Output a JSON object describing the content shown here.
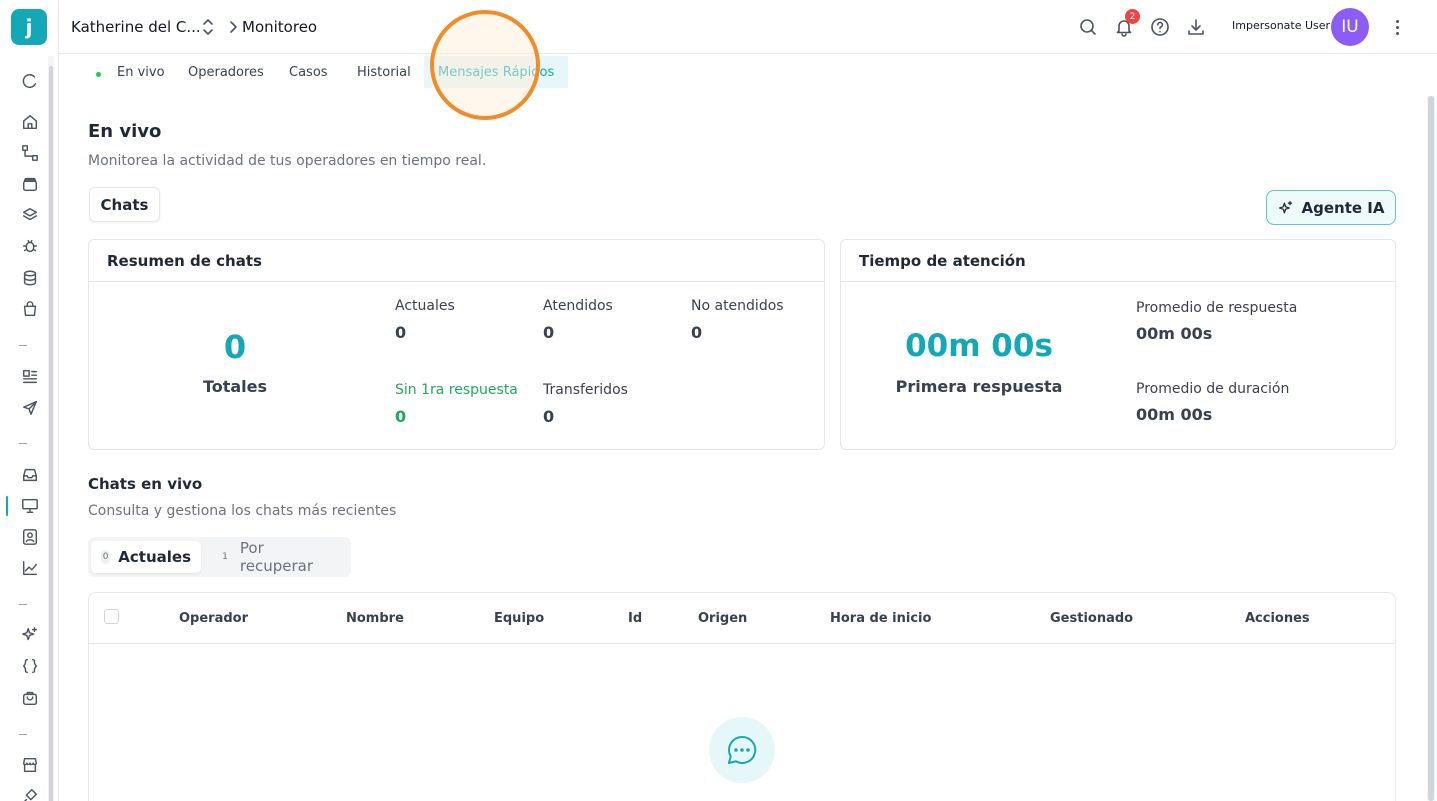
{
  "app": {
    "logo_letter": "j",
    "brand_color": "#13a8b7"
  },
  "header": {
    "breadcrumb_user": "Katherine del C...",
    "breadcrumb_page": "Monitoreo",
    "notification_count": "2",
    "impersonate_label": "Impersonate User",
    "avatar_initials": "IU"
  },
  "tabs": [
    {
      "label": "En vivo"
    },
    {
      "label": "Operadores"
    },
    {
      "label": "Casos"
    },
    {
      "label": "Historial"
    },
    {
      "label": "Mensajes Rápidos",
      "active": true
    }
  ],
  "page": {
    "title": "En vivo",
    "subtitle": "Monitorea la actividad de tus operadores en tiempo real.",
    "chats_button": "Chats",
    "agent_button": "Agente IA"
  },
  "summary": {
    "title": "Resumen de chats",
    "total_value": "0",
    "total_label": "Totales",
    "actuales_label": "Actuales",
    "actuales_value": "0",
    "atendidos_label": "Atendidos",
    "atendidos_value": "0",
    "no_atendidos_label": "No atendidos",
    "no_atendidos_value": "0",
    "sin_respuesta_label": "Sin 1ra respuesta",
    "sin_respuesta_value": "0",
    "transferidos_label": "Transferidos",
    "transferidos_value": "0"
  },
  "attention": {
    "title": "Tiempo de atención",
    "first_value": "00m 00s",
    "first_label": "Primera respuesta",
    "avg_response_label": "Promedio de respuesta",
    "avg_response_value": "00m 00s",
    "avg_duration_label": "Promedio de duración",
    "avg_duration_value": "00m 00s"
  },
  "live_chats": {
    "title": "Chats en vivo",
    "subtitle": "Consulta y gestiona los chats más recientes",
    "seg_current_count": "0",
    "seg_current_label": "Actuales",
    "seg_recover_count": "1",
    "seg_recover_label": "Por recuperar",
    "columns": [
      "Operador",
      "Nombre",
      "Equipo",
      "Id",
      "Origen",
      "Hora de inicio",
      "Gestionado",
      "Acciones"
    ]
  }
}
